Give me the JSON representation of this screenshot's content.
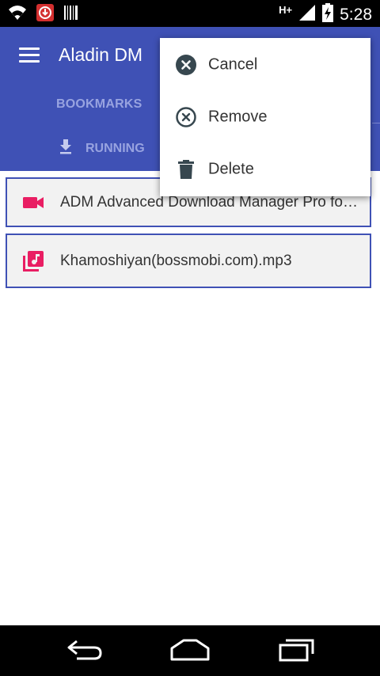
{
  "status_bar": {
    "time": "5:28",
    "network_type": "H+",
    "icons": [
      "wifi-icon",
      "download-notification-icon",
      "barcode-icon",
      "signal-icon",
      "battery-charging-icon"
    ]
  },
  "app_bar": {
    "title": "Aladin DM",
    "menu_icon": "hamburger-icon",
    "tabs": [
      {
        "label": "BOOKMARKS"
      },
      {
        "label": "RUNNING",
        "icon": "download-icon"
      }
    ]
  },
  "list": {
    "items": [
      {
        "label": "ADM Advanced Download Manager Pro for…",
        "icon": "video-camera-icon"
      },
      {
        "label": "Khamoshiyan(bossmobi.com).mp3",
        "icon": "music-library-icon"
      }
    ]
  },
  "popup_menu": {
    "items": [
      {
        "label": "Cancel",
        "icon": "cancel-filled-icon"
      },
      {
        "label": "Remove",
        "icon": "remove-outline-icon"
      },
      {
        "label": "Delete",
        "icon": "trash-icon"
      }
    ]
  },
  "nav_bar": {
    "buttons": [
      "back-icon",
      "home-icon",
      "recents-icon"
    ]
  },
  "colors": {
    "primary": "#3f51b5",
    "accent_pink": "#e91e63",
    "tab_text": "#98a3e0"
  }
}
